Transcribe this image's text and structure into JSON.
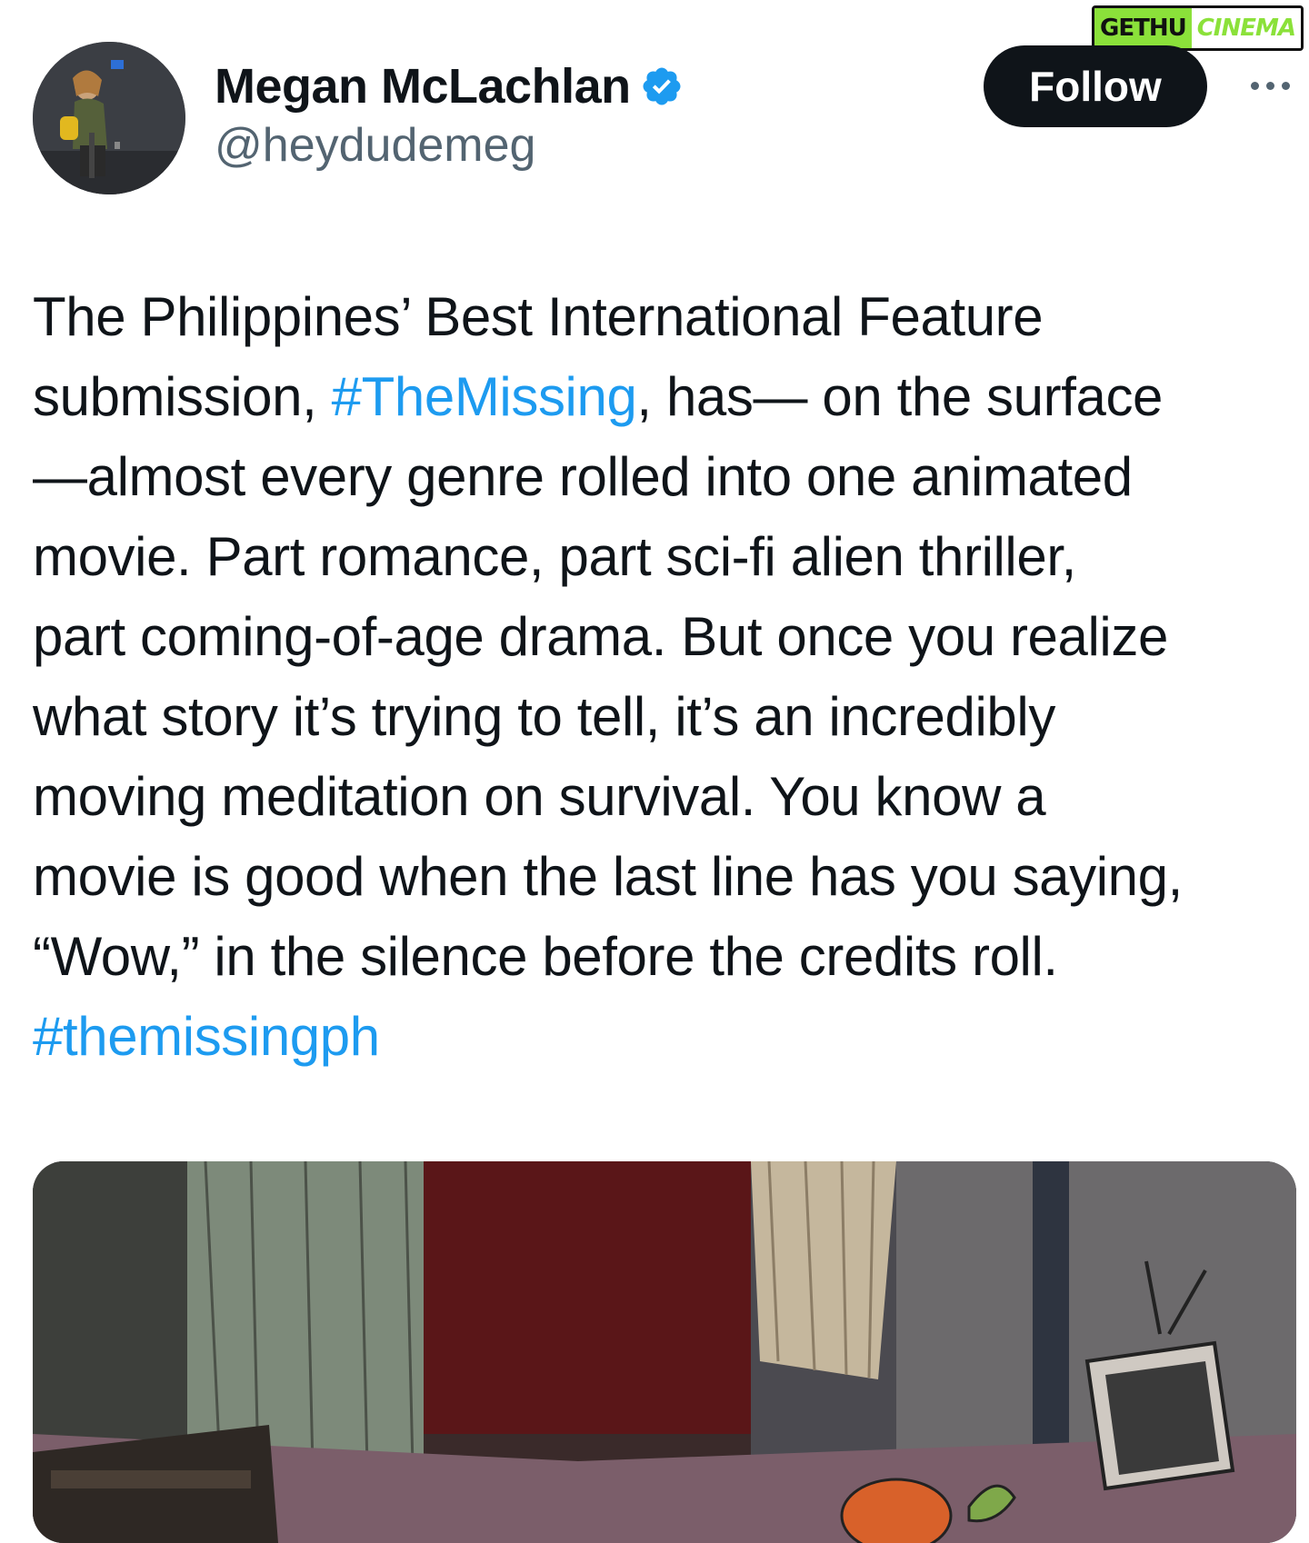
{
  "watermark": {
    "left_text": "GETHU",
    "right_text": "CINEMA"
  },
  "author": {
    "display_name": "Megan McLachlan",
    "handle": "@heydudemeg",
    "verified": true,
    "avatar_icon": "profile-photo"
  },
  "actions": {
    "follow_label": "Follow",
    "more_icon": "more-horizontal-icon"
  },
  "tweet": {
    "line1": "The Philippines’ Best International Feature",
    "line2_pre": "submission, ",
    "line2_tag": "#TheMissing",
    "line2_post": ", has— on the surface",
    "line3": "—almost every genre rolled into one animated",
    "line4": "movie. Part romance, part sci-fi alien thriller,",
    "line5": "part coming-of-age drama. But once you realize",
    "line6": "what story it’s trying to tell, it’s an incredibly",
    "line7": "moving meditation on survival. You know a",
    "line8": "movie is good when the last line has you saying,",
    "line9": "“Wow,” in the silence before the credits roll.",
    "line10_tag": "#themissingph"
  },
  "colors": {
    "text": "#0f1419",
    "secondary": "#536471",
    "link": "#1d9bf0",
    "verified": "#1d9bf0",
    "follow_bg": "#0f1419",
    "watermark_green": "#8be13a"
  },
  "media": {
    "description_icon": "animated-still-image"
  }
}
